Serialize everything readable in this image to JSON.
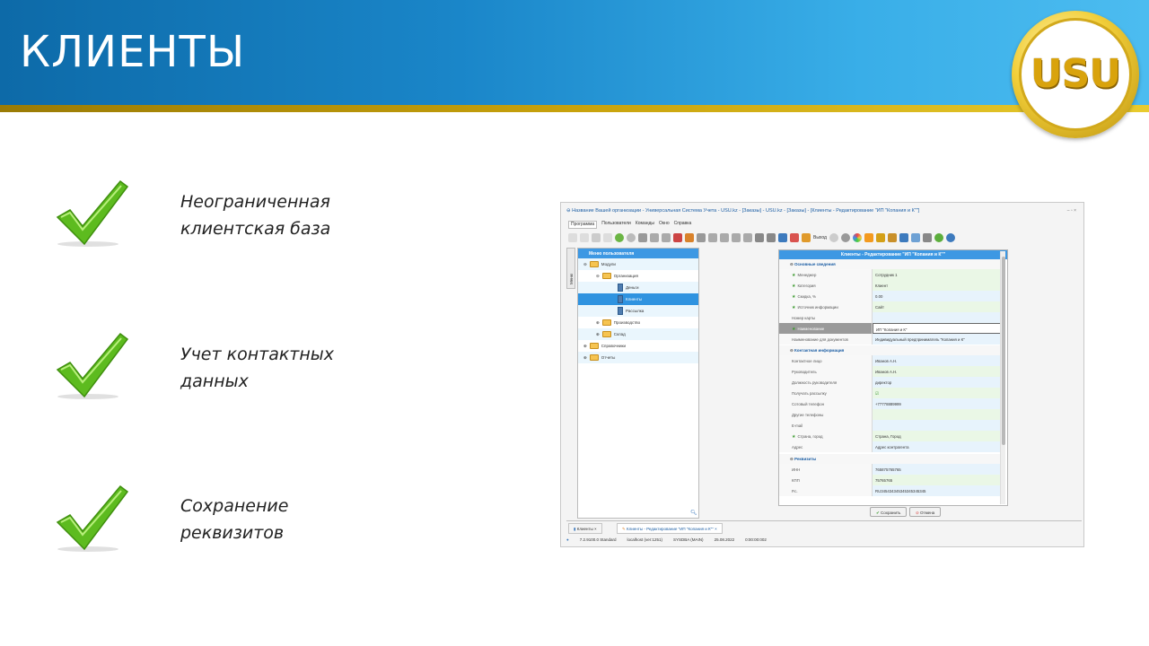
{
  "slide": {
    "title": "КЛИЕНТЫ",
    "logo_text": "USU",
    "features": [
      {
        "line1": "Неограниченная",
        "line2": "клиентская база"
      },
      {
        "line1": "Учет контактных",
        "line2": "данных"
      },
      {
        "line1": "Сохранение",
        "line2": "реквизитов"
      }
    ]
  },
  "app": {
    "window_title": "Название Вашей организации - Универсальная Система Учета - USU.kz - [Заказы] - USU.kz - [Заказы] - [Клиенты - Редактирование \"ИП \"Копания и К\"\"]",
    "window_controls": "– ▫ ×",
    "menu": [
      "Программа",
      "Пользователи",
      "Команды",
      "Окно",
      "Справка"
    ],
    "toolbar_exit": "Выход",
    "side_tab": "Меню",
    "tree": {
      "header": "Меню пользователя",
      "items": [
        "Модули",
        "Организация",
        "Деньги",
        "Клиенты",
        "Рассылка",
        "Производство",
        "Склад",
        "Справочники",
        "Отчеты"
      ]
    },
    "form": {
      "title": "Клиенты - Редактирование \"ИП \"Копания и К\"\"",
      "sections": [
        "Основные сведения",
        "Контактная информация",
        "Реквизиты"
      ],
      "main_rows": [
        {
          "label": "Менеджер",
          "value": "Сотрудник 1"
        },
        {
          "label": "Категория",
          "value": "Клиент"
        },
        {
          "label": "Скидка, %",
          "value": "0.00"
        },
        {
          "label": "Источник информации",
          "value": "Сайт"
        },
        {
          "label": "Номер карты",
          "value": ""
        },
        {
          "label": "Наименование",
          "value": "ИП \"Копания и К\""
        },
        {
          "label": "Наименование для документов",
          "value": "Индивидуальный предприниматель \"Копания и К\""
        }
      ],
      "contact_rows": [
        {
          "label": "Контактное лицо",
          "value": "Иванов А.Н."
        },
        {
          "label": "Руководитель",
          "value": "Иванов А.Н."
        },
        {
          "label": "Должность руководителя",
          "value": "директор"
        },
        {
          "label": "Получать рассылку",
          "value": "☑"
        },
        {
          "label": "Сотовый телефон",
          "value": "+77778889999"
        },
        {
          "label": "Другие телефоны",
          "value": ""
        },
        {
          "label": "E-mail",
          "value": ""
        },
        {
          "label": "Страна, город",
          "value": "Страна, Город"
        },
        {
          "label": "Адрес",
          "value": "Адрес контрагента"
        }
      ],
      "req_rows": [
        {
          "label": "ИНН",
          "value": "765875765765"
        },
        {
          "label": "КПП",
          "value": "75765765"
        },
        {
          "label": "Р.с.",
          "value": "RU345434345345345345345"
        }
      ],
      "save": "Сохранить",
      "cancel": "Отмена"
    },
    "doc_tabs": [
      "Клиенты",
      "Клиенты - Редактирование \"ИП \"Копания и К\"\""
    ],
    "status": [
      "7.2.9100.0 Standard",
      "localhost (ver:1251)",
      "SYSDBA (MAIN)",
      "25.08.2022",
      "0:00:00:002"
    ]
  }
}
